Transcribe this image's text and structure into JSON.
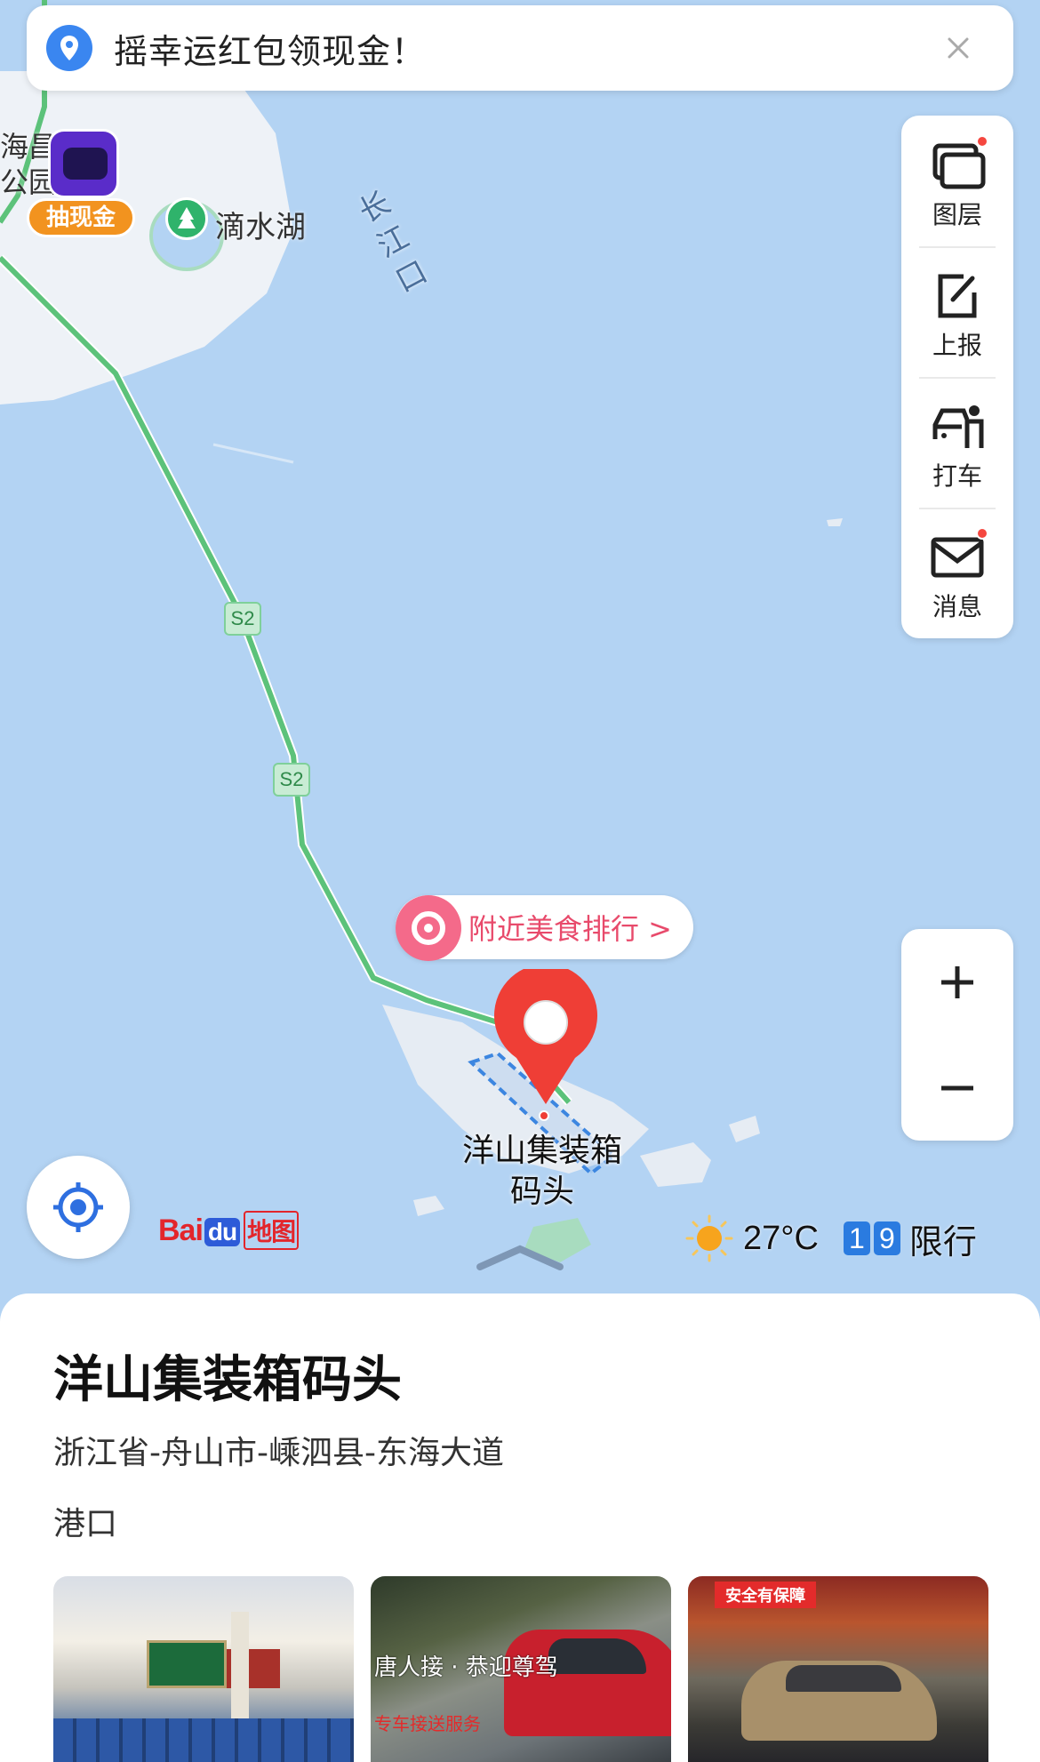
{
  "banner": {
    "text": "摇幸运红包领现金！",
    "icon": "location-pin-icon",
    "close_icon": "close-icon"
  },
  "tools": [
    {
      "label": "图层",
      "icon": "layers-icon",
      "has_dot": true
    },
    {
      "label": "上报",
      "icon": "report-edit-icon",
      "has_dot": false
    },
    {
      "label": "打车",
      "icon": "taxi-icon",
      "has_dot": false
    },
    {
      "label": "消息",
      "icon": "message-mail-icon",
      "has_dot": true
    }
  ],
  "zoom": {
    "in_label": "+",
    "out_label": "−"
  },
  "map": {
    "labels": {
      "district": "海昌公园",
      "lake": "滴水湖",
      "river_mouth": "长江口"
    },
    "road_badges": [
      "S2",
      "S2"
    ],
    "promo_badge": "抽现金",
    "food_tip": "附近美食排行 >",
    "poi_name": "洋山集装箱码头",
    "logo_bai": "Bai",
    "logo_du": "du",
    "logo_ditu": "地图",
    "weather": {
      "temp": "27°C",
      "plates": [
        "1",
        "9"
      ],
      "limit": "限行"
    }
  },
  "place": {
    "name": "洋山集装箱码头",
    "address": "浙江省-舟山市-嵊泗县-东海大道",
    "category": "港口",
    "photos": [
      {
        "caption": ""
      },
      {
        "caption": "唐人接 · 恭迎尊驾",
        "sub": "专车接送服务"
      },
      {
        "caption": "",
        "badge": "安全有保障"
      }
    ]
  },
  "colors": {
    "water": "#b3d3f3",
    "land": "#eef2f7",
    "road": "#5cc27a",
    "accent": "#f5473f",
    "brand": "#2d5bd8"
  }
}
